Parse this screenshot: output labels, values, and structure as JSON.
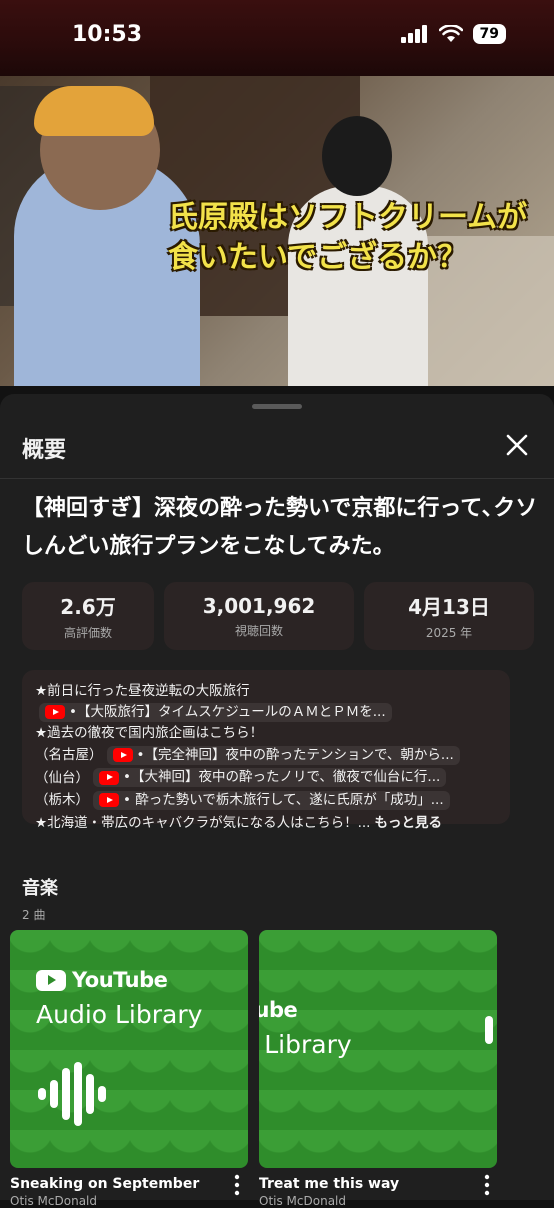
{
  "status_bar": {
    "time": "10:53",
    "battery": "79",
    "icons": [
      "signal-icon",
      "wifi-icon",
      "battery-icon"
    ]
  },
  "video": {
    "caption_line1": "氏原殿はソフトクリームが",
    "caption_line2": "食いたいでござるか？"
  },
  "sheet": {
    "title": "概要",
    "video_title": "【神回すぎ】深夜の酔った勢いで京都に行って､クソしんどい旅行プランをこなしてみた。",
    "stats": [
      {
        "value": "2.6万",
        "label": "高評価数"
      },
      {
        "value": "3,001,962",
        "label": "視聴回数"
      },
      {
        "value": "4月13日",
        "label": "2025 年"
      }
    ],
    "description": {
      "line1": "★前日に行った昼夜逆転の大阪旅行",
      "line2_chip": "•【大阪旅行】タイムスケジュールのＡＭとＰＭを...",
      "line3": "★過去の徹夜で国内旅企画はこちら！",
      "line4_prefix": "（名古屋）",
      "line4_chip": "•【完全神回】夜中の酔ったテンションで、朝から...",
      "line5_prefix": "（仙台）",
      "line5_chip": "•【大神回】夜中の酔ったノリで、徹夜で仙台に行...",
      "line6_prefix": "（栃木）",
      "line6_chip": "• 酔った勢いで栃木旅行して、遂に氏原が「成功」...",
      "line7": "★北海道・帯広のキャバクラが気になる人はこちら！...",
      "more": "もっと見る"
    }
  },
  "music": {
    "title": "音楽",
    "count": "2 曲",
    "tracks": [
      {
        "brand": "YouTube",
        "library": "Audio Library",
        "title": "Sneaking on September",
        "artist": "Otis McDonald"
      },
      {
        "brand": "Tube",
        "library": "o Library",
        "title": "Treat me this way",
        "artist": "Otis McDonald"
      }
    ]
  },
  "colors": {
    "background": "#121212",
    "sheet": "#1f1f1f",
    "card_bg": "#2b2424",
    "album_green": "#2f8d2b",
    "youtube_red": "#ff0000",
    "caption_yellow": "#f2e24a"
  }
}
